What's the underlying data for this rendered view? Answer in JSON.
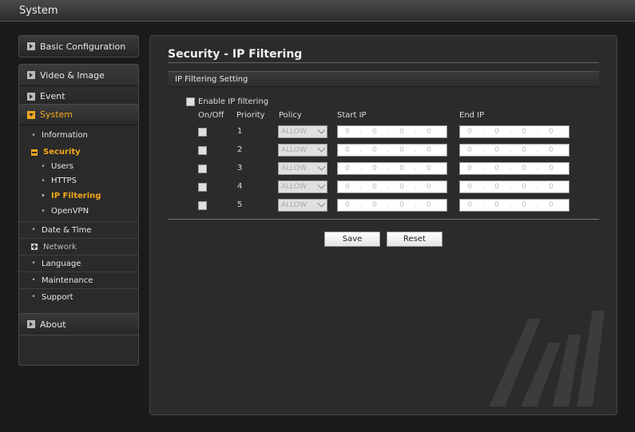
{
  "window": {
    "title": "System"
  },
  "sidebar": {
    "basic_configuration": "Basic Configuration",
    "video_image": "Video & Image",
    "event": "Event",
    "system": "System",
    "items": {
      "information": "Information",
      "security": "Security",
      "users": "Users",
      "https": "HTTPS",
      "ip_filtering": "IP Filtering",
      "openvpn": "OpenVPN",
      "date_time": "Date & Time",
      "network": "Network",
      "language": "Language",
      "maintenance": "Maintenance",
      "support": "Support"
    },
    "about": "About"
  },
  "page": {
    "title": "Security - IP Filtering",
    "section": "IP Filtering Setting",
    "enable_label": "Enable IP filtering",
    "columns": {
      "onoff": "On/Off",
      "priority": "Priority",
      "policy": "Policy",
      "start_ip": "Start IP",
      "end_ip": "End IP"
    },
    "rows": [
      {
        "priority": "1",
        "policy": "ALLOW",
        "start": [
          "0",
          "0",
          "0",
          "0"
        ],
        "end": [
          "0",
          "0",
          "0",
          "0"
        ]
      },
      {
        "priority": "2",
        "policy": "ALLOW",
        "start": [
          "0",
          "0",
          "0",
          "0"
        ],
        "end": [
          "0",
          "0",
          "0",
          "0"
        ]
      },
      {
        "priority": "3",
        "policy": "ALLOW",
        "start": [
          "0",
          "0",
          "0",
          "0"
        ],
        "end": [
          "0",
          "0",
          "0",
          "0"
        ]
      },
      {
        "priority": "4",
        "policy": "ALLOW",
        "start": [
          "0",
          "0",
          "0",
          "0"
        ],
        "end": [
          "0",
          "0",
          "0",
          "0"
        ]
      },
      {
        "priority": "5",
        "policy": "ALLOW",
        "start": [
          "0",
          "0",
          "0",
          "0"
        ],
        "end": [
          "0",
          "0",
          "0",
          "0"
        ]
      }
    ],
    "ip_separator": ".",
    "save_label": "Save",
    "reset_label": "Reset"
  }
}
